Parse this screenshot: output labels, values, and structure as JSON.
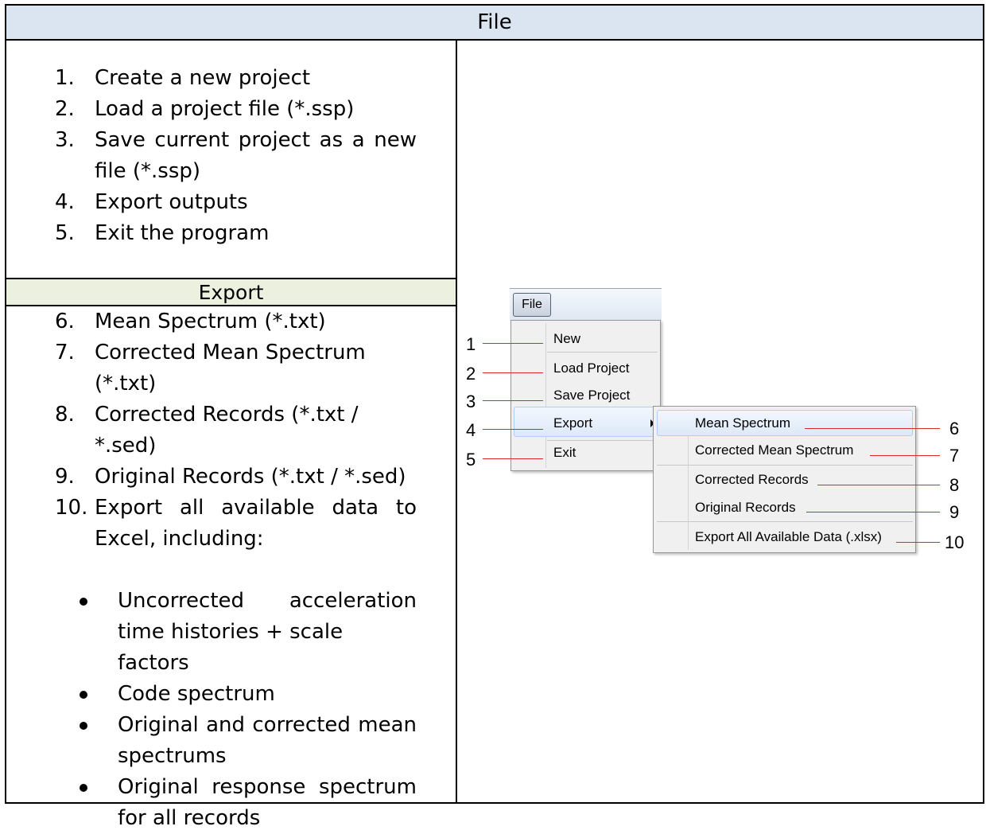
{
  "title": "File",
  "list_top": [
    {
      "num": "1.",
      "text": "Create a new project"
    },
    {
      "num": "2.",
      "text": "Load a project file (*.ssp)"
    },
    {
      "num": "3.",
      "line1": "Save current project as a new",
      "line2": "file (*.ssp)"
    },
    {
      "num": "4.",
      "text": "Export outputs"
    },
    {
      "num": "5.",
      "text": "Exit the program"
    }
  ],
  "export_header": "Export",
  "list_export": [
    {
      "num": "6.",
      "text": "Mean Spectrum (*.txt)"
    },
    {
      "num": "7.",
      "line1": "Corrected Mean Spectrum",
      "line2": "(*.txt)"
    },
    {
      "num": "8.",
      "line1": "Corrected Records (*.txt /",
      "line2": "*.sed)"
    },
    {
      "num": "9.",
      "text": "Original Records (*.txt / *.sed)"
    },
    {
      "num": "10.",
      "line1": "Export all available data to",
      "line2": "Excel, including:"
    }
  ],
  "bullets": [
    {
      "line1": "Uncorrected acceleration",
      "line2": "time histories + scale factors"
    },
    {
      "text": "Code spectrum"
    },
    {
      "line1": "Original and corrected mean",
      "line2": "spectrums"
    },
    {
      "line1": "Original response spectrum",
      "line2": "for all records"
    }
  ],
  "menu": {
    "file_label": "File",
    "main_items": [
      "New",
      "Load Project",
      "Save Project",
      "Export",
      "Exit"
    ],
    "sub_items": [
      "Mean Spectrum",
      "Corrected Mean Spectrum",
      "Corrected Records",
      "Original Records",
      "Export All Available Data (.xlsx)"
    ]
  },
  "callouts": [
    "1",
    "2",
    "3",
    "4",
    "5",
    "6",
    "7",
    "8",
    "9",
    "10"
  ],
  "colors": {
    "title_bg": "#dbe5f1",
    "export_bg": "#ebf1de",
    "callout_line": "#d62b2b"
  }
}
